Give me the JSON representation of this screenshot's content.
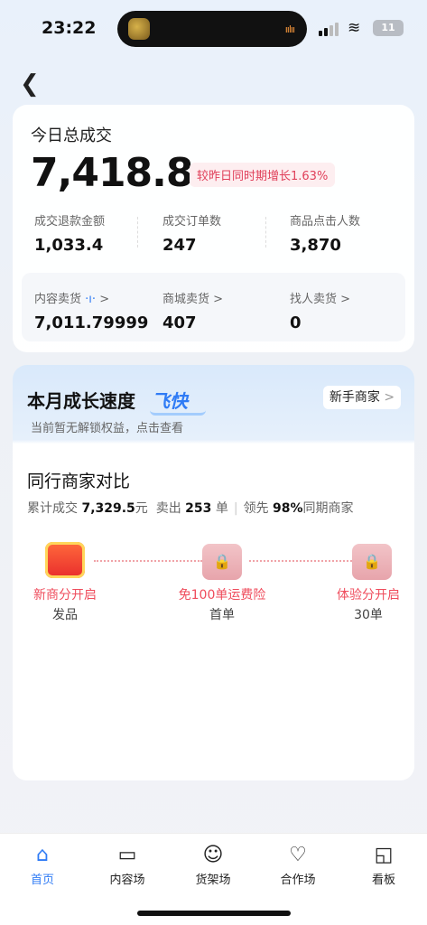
{
  "status": {
    "time": "23:22",
    "battery": "11"
  },
  "summary": {
    "title": "今日总成交",
    "total": "7,418.8",
    "growth_badge": "较昨日同时期增长1.63%",
    "stats": [
      {
        "label": "成交退款金额",
        "value": "1,033.4"
      },
      {
        "label": "成交订单数",
        "value": "247"
      },
      {
        "label": "商品点击人数",
        "value": "3,870"
      }
    ],
    "channels": [
      {
        "label": "内容卖货",
        "value": "7,011.79999"
      },
      {
        "label": "商城卖货",
        "value": "407"
      },
      {
        "label": "找人卖货",
        "value": "0"
      }
    ]
  },
  "growth": {
    "title": "本月成长速度",
    "speed": "飞快",
    "new_merchant_button": "新手商家",
    "subtitle": "当前暂无解锁权益，点击查看"
  },
  "compare": {
    "title": "同行商家对比",
    "cumulative_label": "累计成交",
    "cumulative_value": "7,329.5",
    "cumulative_unit": "元",
    "sold_label": "卖出",
    "sold_value": "253",
    "sold_unit": "单",
    "lead_label": "领先",
    "lead_value": "98%",
    "lead_suffix": "同期商家",
    "steps": [
      {
        "label": "新商分开启",
        "sub": "发品"
      },
      {
        "label": "免100单运费险",
        "sub": "首单"
      },
      {
        "label": "体验分开启",
        "sub": "30单"
      }
    ]
  },
  "tabs": [
    {
      "label": "首页",
      "icon": "home-icon"
    },
    {
      "label": "内容场",
      "icon": "video-icon"
    },
    {
      "label": "货架场",
      "icon": "bag-icon"
    },
    {
      "label": "合作场",
      "icon": "heart-icon"
    },
    {
      "label": "看板",
      "icon": "chart-icon"
    }
  ],
  "colors": {
    "accent": "#2f7bf5",
    "badge_text": "#e0405a",
    "step_text": "#ef4c5c"
  }
}
